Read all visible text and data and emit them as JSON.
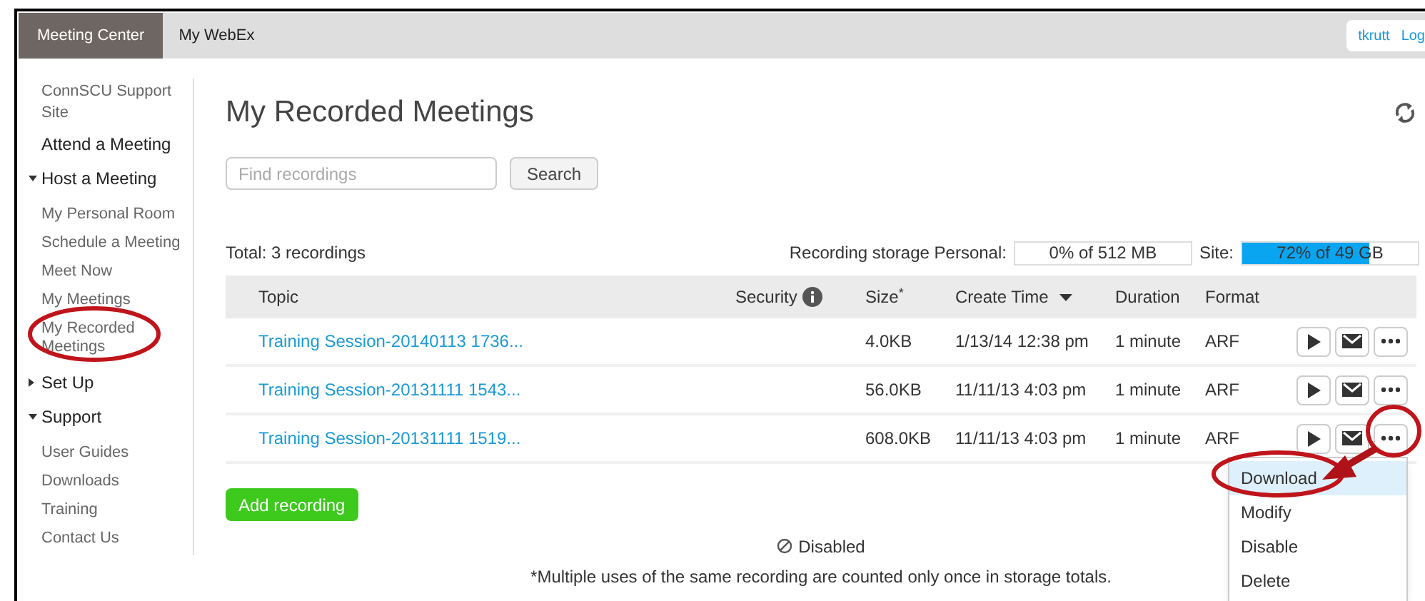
{
  "top_nav": {
    "tabs": [
      {
        "label": "Meeting Center",
        "selected": true
      },
      {
        "label": "My WebEx",
        "selected": false
      }
    ],
    "user_links": [
      "tkrutt",
      "Log"
    ]
  },
  "sidebar": {
    "items": [
      {
        "label": "ConnSCU Support Site",
        "kind": "link"
      },
      {
        "label": "Attend a Meeting",
        "kind": "section"
      },
      {
        "label": "Host a Meeting",
        "kind": "group",
        "expanded": true,
        "children": [
          {
            "label": "My Personal Room"
          },
          {
            "label": "Schedule a Meeting"
          },
          {
            "label": "Meet Now"
          },
          {
            "label": "My Meetings"
          },
          {
            "label": "My Recorded Meetings"
          }
        ]
      },
      {
        "label": "Set Up",
        "kind": "group",
        "expanded": false
      },
      {
        "label": "Support",
        "kind": "group",
        "expanded": true,
        "children": [
          {
            "label": "User Guides"
          },
          {
            "label": "Downloads"
          },
          {
            "label": "Training"
          },
          {
            "label": "Contact Us"
          }
        ]
      }
    ]
  },
  "page_title": "My Recorded Meetings",
  "search": {
    "placeholder": "Find recordings",
    "button": "Search"
  },
  "total": "Total: 3 recordings",
  "storage": {
    "label": "Recording storage Personal:",
    "personal": {
      "reading": "0% of 512 MB",
      "level": 0
    },
    "site_label": "Site:",
    "site": {
      "reading": "72% of 49 GB",
      "level": 0.72
    }
  },
  "table": {
    "columns": [
      "Topic",
      "Security",
      "Size$^{*}$",
      "Create Time",
      "Duration",
      "Format"
    ],
    "rows": [
      {
        "topic": "Training Session-20140113 1736...",
        "size": "4.0KB",
        "create_time": "1/13/14 12:38 pm",
        "duration": "1 minute",
        "format": "ARF"
      },
      {
        "topic": "Training Session-20131111 1543...",
        "size": "56.0KB",
        "create_time": "11/11/13 4:03 pm",
        "duration": "1 minute",
        "format": "ARF"
      },
      {
        "topic": "Training Session-20131111 1519...",
        "size": "608.0KB",
        "create_time": "11/11/13 4:03 pm",
        "duration": "1 minute",
        "format": "ARF"
      }
    ]
  },
  "add_button": "Add recording",
  "legend": "Disabled",
  "footnote": "*Multiple uses of the same recording are counted only once in storage totals.",
  "menu": {
    "items": [
      {
        "label": "Download",
        "highlighted": true
      },
      {
        "label": "Modify",
        "highlighted": false
      },
      {
        "label": "Disable",
        "highlighted": false
      },
      {
        "label": "Delete",
        "highlighted": false
      }
    ]
  }
}
